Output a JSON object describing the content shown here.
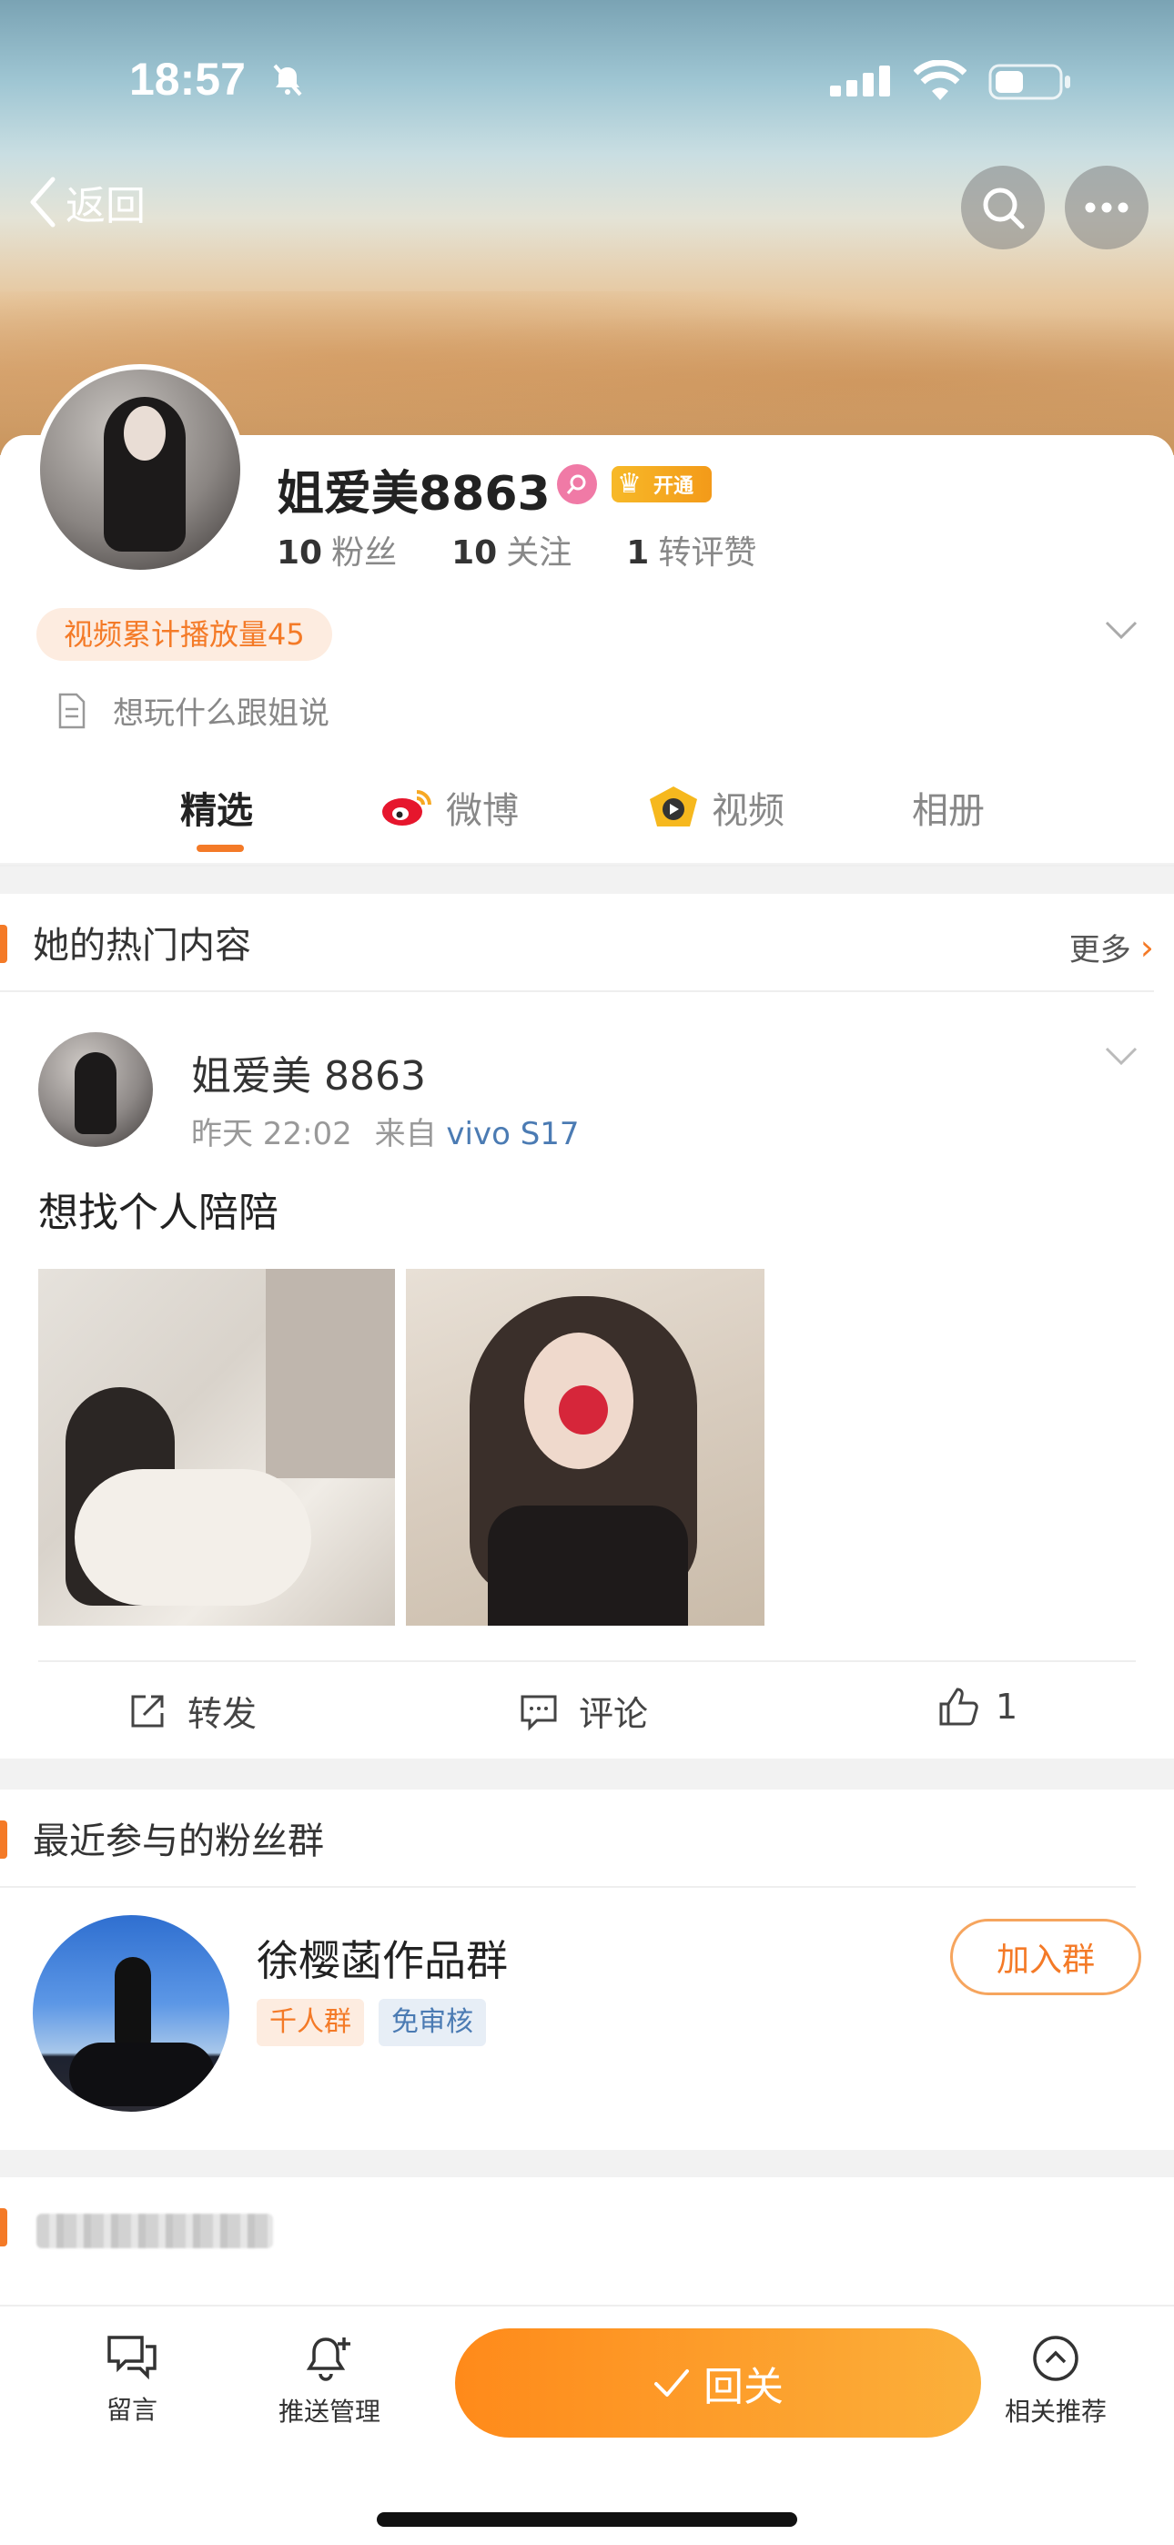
{
  "status_bar": {
    "time": "18:57"
  },
  "nav": {
    "back_label": "返回"
  },
  "profile": {
    "name": "姐爱美8863",
    "open_badge": "开通",
    "stats": [
      {
        "value": "10",
        "label": "粉丝"
      },
      {
        "value": "10",
        "label": "关注"
      },
      {
        "value": "1",
        "label": "转评赞"
      }
    ],
    "play_count_pill": "视频累计播放量45",
    "bio": "想玩什么跟姐说"
  },
  "tabs": [
    {
      "label": "精选",
      "active": true
    },
    {
      "label": "微博",
      "active": false
    },
    {
      "label": "视频",
      "active": false
    },
    {
      "label": "相册",
      "active": false
    }
  ],
  "hot_section": {
    "title": "她的热门内容",
    "more_label": "更多",
    "post": {
      "author": "姐爱美 8863",
      "time": "昨天 22:02",
      "source_prefix": "来自",
      "device": "vivo S17",
      "text": "想找个人陪陪",
      "actions": {
        "repost": "转发",
        "comment": "评论",
        "like_count": "1"
      }
    }
  },
  "fan_group_section": {
    "title": "最近参与的粉丝群",
    "group": {
      "name": "徐樱菡作品群",
      "tags": [
        "千人群",
        "免审核"
      ],
      "join_label": "加入群"
    }
  },
  "bottom_bar": {
    "message_label": "留言",
    "push_label": "推送管理",
    "follow_label": "回关",
    "related_label": "相关推荐"
  },
  "colors": {
    "accent": "#f47a27",
    "link": "#4b7bb3"
  }
}
